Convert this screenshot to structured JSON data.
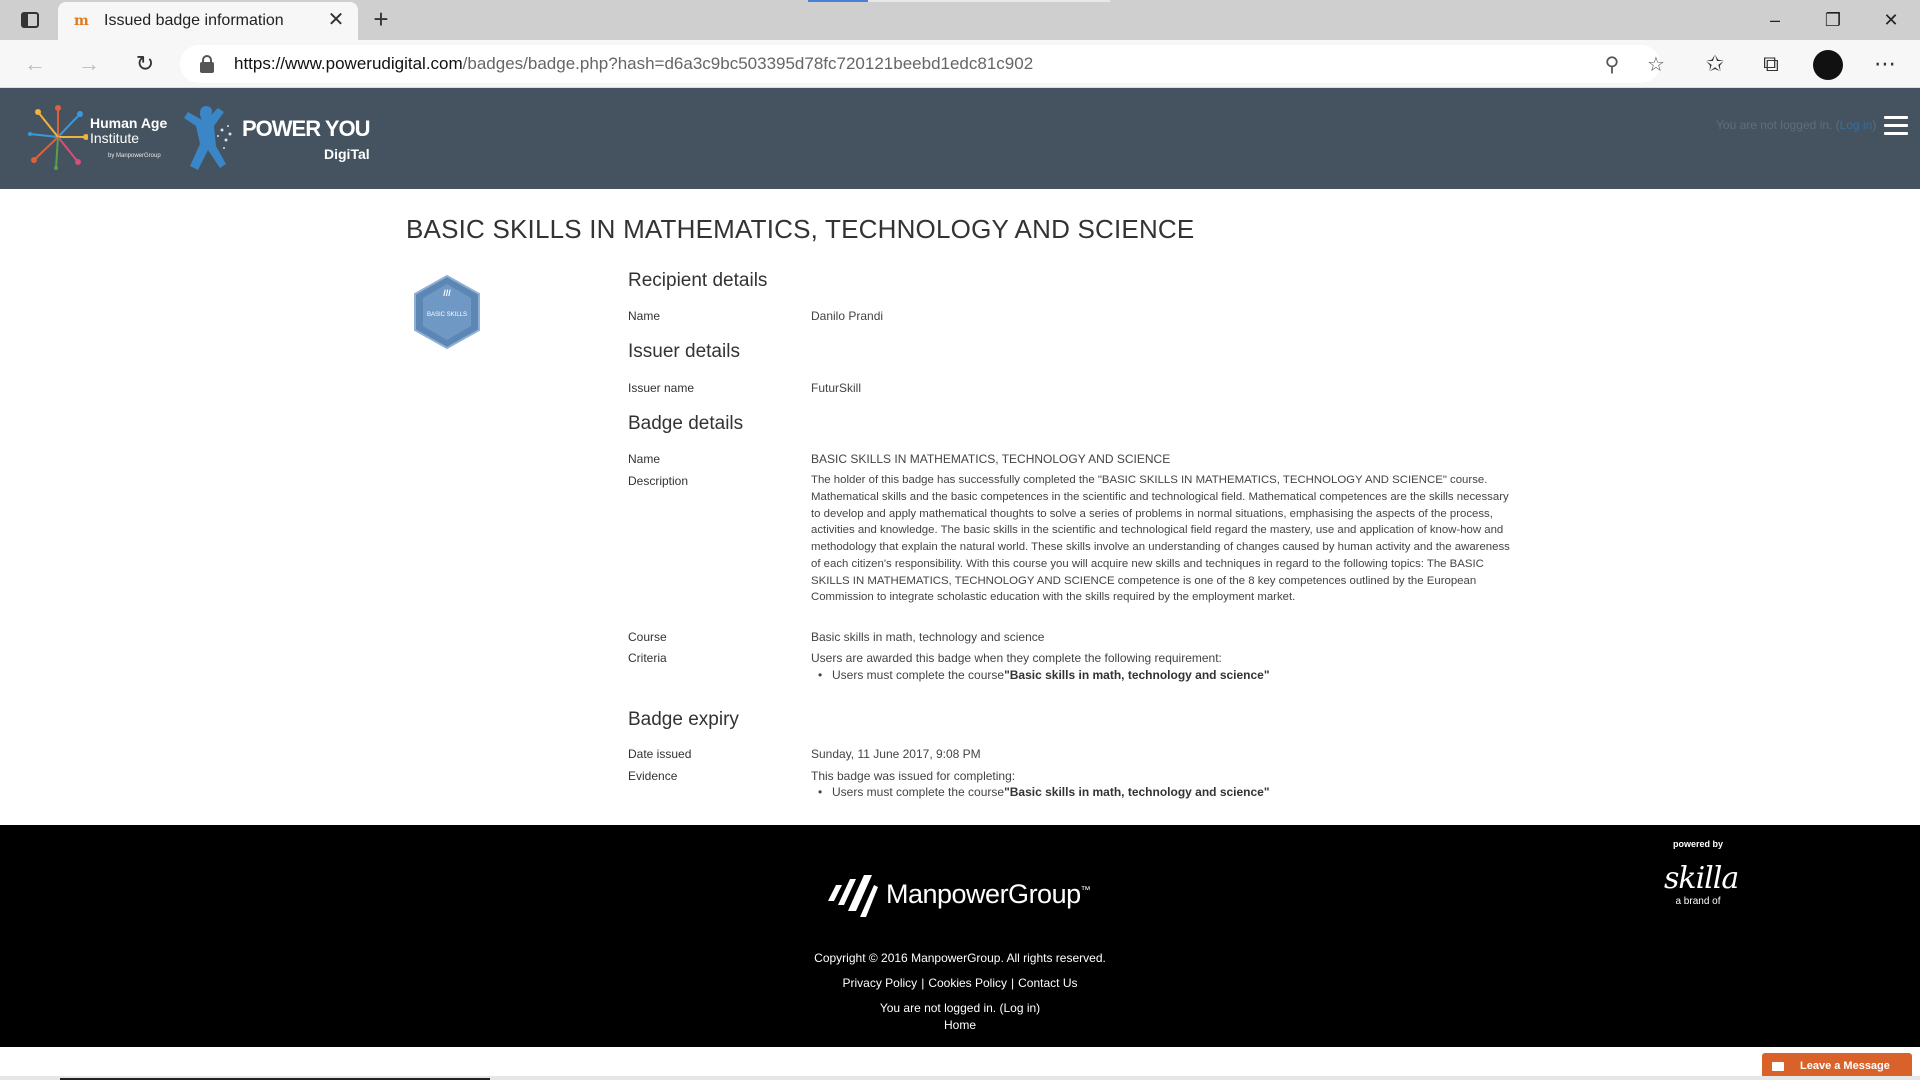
{
  "browser": {
    "tab_title": "Issued badge information",
    "url_host": "https://www.powerudigital.com",
    "url_path": "/badges/badge.php?hash=d6a3c9bc503395d78fc720121beebd1edc81c902"
  },
  "header": {
    "logo_hai_line1": "Human Age",
    "logo_hai_line2": "Institute",
    "logo_hai_small": "by ManpowerGroup",
    "logo_py_main": "POWER YOU",
    "logo_py_sub": "DigiTal",
    "login_text": "You are not logged in. (",
    "login_link": "Log in",
    "login_close": ")"
  },
  "page": {
    "title": "BASIC SKILLS IN MATHEMATICS, TECHNOLOGY AND SCIENCE",
    "badge_image_label": "BASIC SKILLS",
    "recipient": {
      "heading": "Recipient details",
      "name_label": "Name",
      "name_value": "Danilo Prandi"
    },
    "issuer": {
      "heading": "Issuer details",
      "name_label": "Issuer name",
      "name_value": "FuturSkill"
    },
    "badge": {
      "heading": "Badge details",
      "name_label": "Name",
      "name_value": "BASIC SKILLS IN MATHEMATICS, TECHNOLOGY AND SCIENCE",
      "description_label": "Description",
      "description_value": "The holder of this badge has successfully completed the \"BASIC SKILLS IN MATHEMATICS, TECHNOLOGY AND SCIENCE\" course. Mathematical skills and the basic competences in the scientific and technological field. Mathematical competences are the skills necessary to develop and apply mathematical thoughts to solve a series of problems in normal situations, emphasising the aspects of the process, activities and knowledge. The basic skills in the scientific and technological field regard the mastery, use and application of know-how and methodology that explain the natural world. These skills involve an understanding of changes caused by human activity and the awareness of each citizen's responsibility. With this course you will acquire new skills and techniques in regard to the following topics: The BASIC SKILLS IN MATHEMATICS, TECHNOLOGY AND SCIENCE competence is one of the 8 key competences outlined by the European Commission to integrate scholastic education with the skills required by the employment market.",
      "course_label": "Course",
      "course_value": "Basic skills in math, technology and science",
      "criteria_label": "Criteria",
      "criteria_intro": "Users are awarded this badge when they complete the following requirement:",
      "criteria_item_prefix": "Users must complete the course",
      "criteria_item_course": "\"Basic skills in math, technology and science\""
    },
    "expiry": {
      "heading": "Badge expiry",
      "date_label": "Date issued",
      "date_value": "Sunday, 11 June 2017, 9:08 PM",
      "evidence_label": "Evidence",
      "evidence_intro": "This badge was issued for completing:",
      "evidence_item_prefix": "Users must complete the course",
      "evidence_item_course": "\"Basic skills in math, technology and science\""
    }
  },
  "footer": {
    "powered_by": "powered by",
    "skilla_logo": "skilla",
    "skilla_sub": "a brand of",
    "manpower_logo": "ManpowerGroup",
    "manpower_tm": "™",
    "copyright": "Copyright © 2016 ManpowerGroup. All rights reserved.",
    "privacy": "Privacy Policy",
    "cookies": "Cookies Policy",
    "contact": "Contact Us",
    "login_text": "You are not logged in. (",
    "login_link": "Log in",
    "login_close": ")",
    "home": "Home"
  },
  "widget": {
    "leave_message": "Leave a Message"
  },
  "colors": {
    "header_bg": "#44535f",
    "footer_bg": "#000000",
    "leave_message_bg": "#d9622b",
    "badge_hex": "#5c86b4"
  }
}
